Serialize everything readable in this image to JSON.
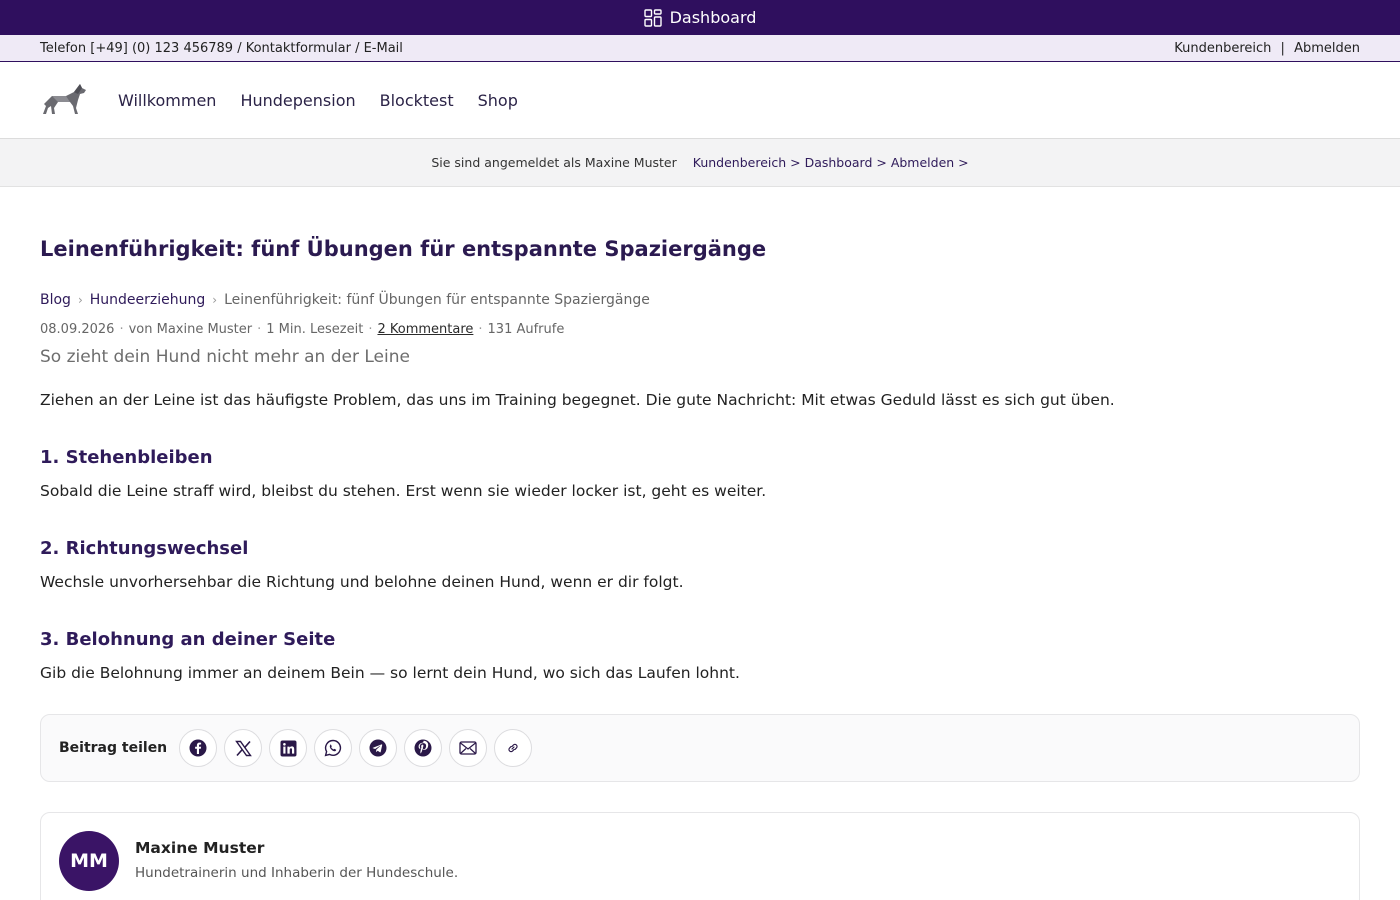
{
  "topbar": {
    "label": "Dashboard",
    "icon": "dashboard-icon"
  },
  "contact": {
    "left": "Telefon [+49] (0) 123 456789 / Kontaktformular / E-Mail",
    "customer_area": "Kundenbereich",
    "separator": "|",
    "logout": "Abmelden"
  },
  "nav": {
    "logo": "dog-logo",
    "items": [
      "Willkommen",
      "Hundepension",
      "Blocktest",
      "Shop"
    ]
  },
  "login": {
    "status": "Sie sind angemeldet als Maxine Muster",
    "links": "Kundenbereich > Dashboard > Abmelden >"
  },
  "post": {
    "title": "Leinenführigkeit: fünf Übungen für entspannte Spaziergänge",
    "breadcrumb": {
      "items": [
        "Blog",
        "Hundeerziehung"
      ],
      "current": "Leinenführigkeit: fünf Übungen für entspannte Spaziergänge",
      "separator": "›"
    },
    "meta": {
      "date": "08.09.2026",
      "author": "von Maxine Muster",
      "reading_time": "1 Min. Lesezeit",
      "comments": "2 Kommentare",
      "views": "131 Aufrufe",
      "dot": "·"
    },
    "subtitle": "So zieht dein Hund nicht mehr an der Leine",
    "lead": "Ziehen an der Leine ist das häufigste Problem, das uns im Training begegnet. Die gute Nachricht: Mit etwas Geduld lässt es sich gut üben.",
    "sections": [
      {
        "heading": "1. Stehenbleiben",
        "text": "Sobald die Leine straff wird, bleibst du stehen. Erst wenn sie wieder locker ist, geht es weiter."
      },
      {
        "heading": "2. Richtungswechsel",
        "text": "Wechsle unvorhersehbar die Richtung und belohne deinen Hund, wenn er dir folgt."
      },
      {
        "heading": "3. Belohnung an deiner Seite",
        "text": "Gib die Belohnung immer an deinem Bein — so lernt dein Hund, wo sich das Laufen lohnt."
      }
    ]
  },
  "share": {
    "label": "Beitrag teilen",
    "buttons": [
      "facebook-icon",
      "x-icon",
      "linkedin-icon",
      "whatsapp-icon",
      "telegram-icon",
      "pinterest-icon",
      "email-icon",
      "link-icon"
    ]
  },
  "author": {
    "initials": "MM",
    "name": "Maxine Muster",
    "bio": "Hundetrainerin und Inhaberin der Hundeschule."
  },
  "colors": {
    "brand": "#2f0f5e",
    "heading": "#2f1b5a",
    "avatar": "#3a1466"
  }
}
